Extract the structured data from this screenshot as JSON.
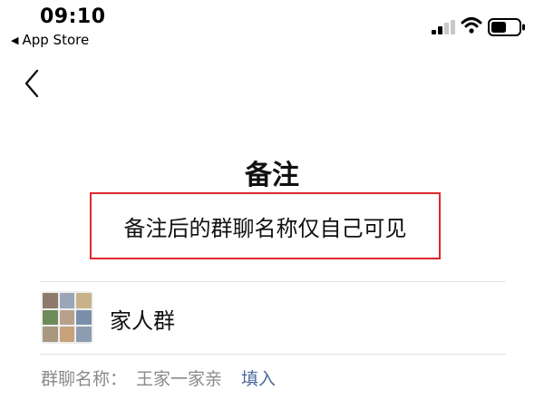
{
  "status_bar": {
    "time": "09:10",
    "back_app": "App Store",
    "signal_icon": "cellular-signal-icon",
    "wifi_icon": "wifi-icon",
    "battery_icon": "battery-icon"
  },
  "nav": {
    "back_icon": "chevron-left-icon"
  },
  "page": {
    "title": "备注",
    "subtitle": "备注后的群聊名称仅自己可见"
  },
  "group": {
    "name": "家人群",
    "avatar_tiles": [
      "#8d7a6a",
      "#9aa6b8",
      "#c9b28a",
      "#6f8a5a",
      "#b8a08a",
      "#7a8fa8",
      "#a89880",
      "#c7a27a",
      "#8d9db0"
    ]
  },
  "group_name_row": {
    "label": "群聊名称：",
    "value": "王家一家亲",
    "action": "填入"
  },
  "colors": {
    "highlight_border": "#e0262c",
    "link": "#4a6a9a",
    "secondary_text": "#8a8a8a"
  }
}
